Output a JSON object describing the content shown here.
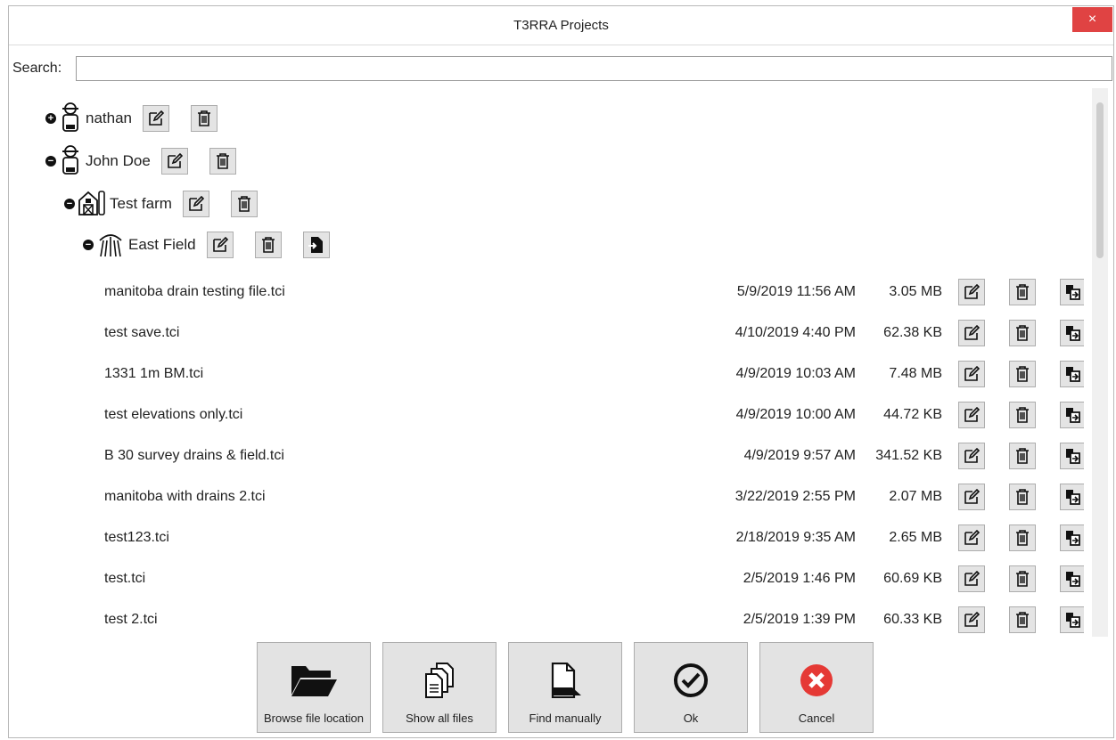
{
  "window": {
    "title": "T3RRA Projects",
    "close_glyph": "×"
  },
  "search": {
    "label": "Search:",
    "value": "",
    "placeholder": ""
  },
  "tree": {
    "nodes": [
      {
        "label": "nathan",
        "expander": "+",
        "icon": "farmer-icon"
      },
      {
        "label": "John Doe",
        "expander": "−",
        "icon": "farmer-icon"
      },
      {
        "label": "Test farm",
        "expander": "−",
        "icon": "barn-icon"
      },
      {
        "label": "East Field",
        "expander": "−",
        "icon": "sprinkler-icon"
      }
    ]
  },
  "files": [
    {
      "name": "manitoba drain testing file.tci",
      "date": "5/9/2019 11:56 AM",
      "size": "3.05 MB"
    },
    {
      "name": "test save.tci",
      "date": "4/10/2019 4:40 PM",
      "size": "62.38 KB"
    },
    {
      "name": "1331 1m BM.tci",
      "date": "4/9/2019 10:03 AM",
      "size": "7.48 MB"
    },
    {
      "name": "test elevations only.tci",
      "date": "4/9/2019 10:00 AM",
      "size": "44.72 KB"
    },
    {
      "name": "B 30 survey drains & field.tci",
      "date": "4/9/2019 9:57 AM",
      "size": "341.52 KB"
    },
    {
      "name": "manitoba with drains 2.tci",
      "date": "3/22/2019 2:55 PM",
      "size": "2.07 MB"
    },
    {
      "name": "test123.tci",
      "date": "2/18/2019 9:35 AM",
      "size": "2.65 MB"
    },
    {
      "name": "test.tci",
      "date": "2/5/2019 1:46 PM",
      "size": "60.69 KB"
    },
    {
      "name": "test 2.tci",
      "date": "2/5/2019 1:39 PM",
      "size": "60.33 KB"
    }
  ],
  "buttons": {
    "browse": "Browse file location",
    "show_all": "Show all files",
    "find": "Find manually",
    "ok": "Ok",
    "cancel": "Cancel"
  },
  "colors": {
    "close": "#e04343",
    "cancel_icon": "#e53935",
    "button_bg": "#e3e3e3"
  }
}
